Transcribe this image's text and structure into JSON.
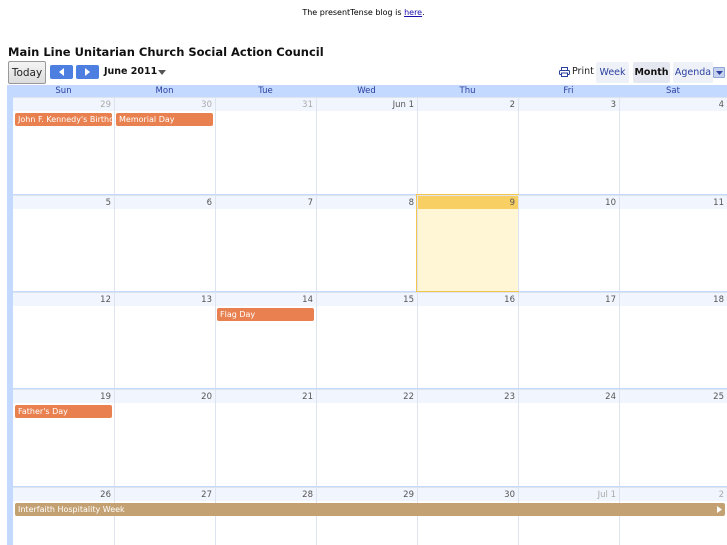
{
  "top_note": {
    "text": "The presentTense blog is ",
    "link": "here",
    "after": "."
  },
  "calendar_title": "Main Line Unitarian Church Social Action Council",
  "toolbar": {
    "today_label": "Today",
    "month_label": "June 2011",
    "print_label": "Print",
    "week_label": "Week",
    "month_view_label": "Month",
    "agenda_label": "Agenda"
  },
  "days_of_week": [
    "Sun",
    "Mon",
    "Tue",
    "Wed",
    "Thu",
    "Fri",
    "Sat"
  ],
  "weeks": [
    {
      "days": [
        {
          "label": "29",
          "other": true
        },
        {
          "label": "30",
          "other": true
        },
        {
          "label": "31",
          "other": true
        },
        {
          "label": "Jun 1"
        },
        {
          "label": "2"
        },
        {
          "label": "3"
        },
        {
          "label": "4"
        }
      ],
      "events": [
        {
          "title": "John F. Kennedy's Birthday",
          "start": 0,
          "span": 1,
          "color": "orange"
        },
        {
          "title": "Memorial Day",
          "start": 1,
          "span": 1,
          "color": "orange"
        }
      ]
    },
    {
      "days": [
        {
          "label": "5"
        },
        {
          "label": "6"
        },
        {
          "label": "7"
        },
        {
          "label": "8"
        },
        {
          "label": "9",
          "today": true
        },
        {
          "label": "10"
        },
        {
          "label": "11"
        }
      ],
      "events": []
    },
    {
      "days": [
        {
          "label": "12"
        },
        {
          "label": "13"
        },
        {
          "label": "14"
        },
        {
          "label": "15"
        },
        {
          "label": "16"
        },
        {
          "label": "17"
        },
        {
          "label": "18"
        }
      ],
      "events": [
        {
          "title": "Flag Day",
          "start": 2,
          "span": 1,
          "color": "orange"
        }
      ]
    },
    {
      "days": [
        {
          "label": "19"
        },
        {
          "label": "20"
        },
        {
          "label": "21"
        },
        {
          "label": "22"
        },
        {
          "label": "23"
        },
        {
          "label": "24"
        },
        {
          "label": "25"
        }
      ],
      "events": [
        {
          "title": "Father's Day",
          "start": 0,
          "span": 1,
          "color": "orange"
        }
      ]
    },
    {
      "days": [
        {
          "label": "26"
        },
        {
          "label": "27"
        },
        {
          "label": "28"
        },
        {
          "label": "29"
        },
        {
          "label": "30"
        },
        {
          "label": "Jul 1",
          "other": true
        },
        {
          "label": "2",
          "other": true
        }
      ],
      "events": [
        {
          "title": "Interfaith Hospitality Week",
          "start": 0,
          "span": 7,
          "color": "tan",
          "continues": true
        }
      ]
    }
  ],
  "colors": {
    "orange": "#e8804f",
    "tan": "#c3a173",
    "today": "#fff6d6",
    "accent": "#4d7fe0"
  }
}
